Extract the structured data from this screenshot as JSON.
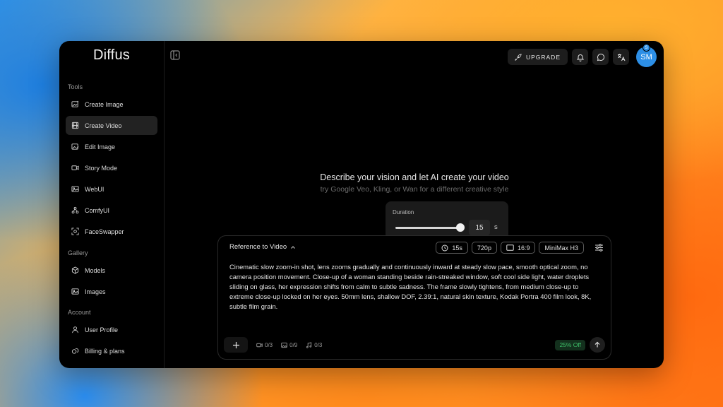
{
  "app": {
    "title": "Diffus"
  },
  "sidebar": {
    "sections": {
      "tools": "Tools",
      "gallery": "Gallery",
      "account": "Account"
    },
    "items": [
      {
        "label": "Create Image",
        "icon": "image-sparkle-icon"
      },
      {
        "label": "Create Video",
        "icon": "film-icon"
      },
      {
        "label": "Edit Image",
        "icon": "image-edit-icon"
      },
      {
        "label": "Story Mode",
        "icon": "camera-icon"
      },
      {
        "label": "WebUI",
        "icon": "image-icon"
      },
      {
        "label": "ComfyUI",
        "icon": "nodes-icon"
      },
      {
        "label": "FaceSwapper",
        "icon": "face-swap-icon"
      },
      {
        "label": "Models",
        "icon": "cube-icon"
      },
      {
        "label": "Images",
        "icon": "images-icon"
      },
      {
        "label": "User Profile",
        "icon": "user-icon"
      },
      {
        "label": "Billing & plans",
        "icon": "coins-icon"
      }
    ],
    "active": "Create Video"
  },
  "topbar": {
    "upgrade_label": "UPGRADE",
    "avatar_initials": "SM",
    "avatar_badge": "S"
  },
  "hero": {
    "title": "Describe your vision and let AI create your video",
    "subtitle": "try Google Veo, Kling, or Wan for a different creative style"
  },
  "duration": {
    "label": "Duration",
    "value": "15",
    "unit": "s",
    "slider_fraction": 1.0
  },
  "composer": {
    "mode": "Reference to Video",
    "chips": {
      "duration": "15s",
      "resolution": "720p",
      "aspect": "16:9",
      "model": "MiniMax H3"
    },
    "prompt": "Cinematic slow zoom-in shot, lens zooms gradually and continuously inward at steady slow pace, smooth optical zoom, no camera position movement. Close-up of a woman standing beside rain-streaked window, soft cool side light, water droplets sliding on glass, her expression shifts from calm to subtle sadness. The frame slowly tightens, from medium close-up to extreme close-up locked on her eyes. 50mm lens, shallow DOF, 2.39:1, natural skin texture, Kodak Portra 400 film look, 8K, subtle film grain.",
    "counters": {
      "video": "0/3",
      "image": "0/9",
      "audio": "0/3"
    },
    "discount": "25% Off"
  },
  "colors": {
    "accent_avatar": "#2d8fe6",
    "discount_text": "#3fc06a",
    "window_bg": "#000000"
  }
}
